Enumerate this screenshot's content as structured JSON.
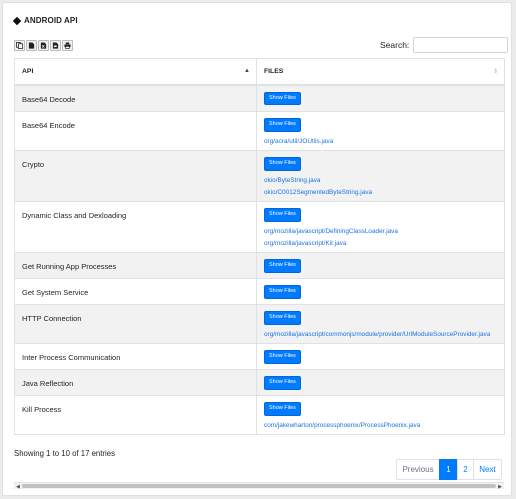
{
  "title": "ANDROID API",
  "toolbar": {
    "icons": [
      "copy-icon",
      "csv-icon",
      "excel-icon",
      "pdf-icon",
      "print-icon"
    ]
  },
  "search": {
    "label": "Search:",
    "value": "",
    "placeholder": ""
  },
  "table": {
    "headers": {
      "api": "API",
      "files": "FILES"
    },
    "button_label": "Show Files",
    "rows": [
      {
        "api": "Base64 Decode",
        "files": []
      },
      {
        "api": "Base64 Encode",
        "files": [
          "org/acra/util/JOUtils.java"
        ]
      },
      {
        "api": "Crypto",
        "files": [
          "okio/ByteString.java",
          "okio/C0012SegmentedByteString.java"
        ]
      },
      {
        "api": "Dynamic Class and Dexloading",
        "files": [
          "org/mozilla/javascript/DefiningClassLoader.java",
          "org/mozilla/javascript/Kit.java"
        ]
      },
      {
        "api": "Get Running App Processes",
        "files": []
      },
      {
        "api": "Get System Service",
        "files": []
      },
      {
        "api": "HTTP Connection",
        "files": [
          "org/mozilla/javascript/commonjs/module/provider/UrlModuleSourceProvider.java"
        ]
      },
      {
        "api": "Inter Process Communication",
        "files": []
      },
      {
        "api": "Java Reflection",
        "files": []
      },
      {
        "api": "Kill Process",
        "files": [
          "com/jakewharton/processphoenix/ProcessPhoenix.java"
        ]
      }
    ]
  },
  "info": "Showing 1 to 10 of 17 entries",
  "pagination": {
    "previous": "Previous",
    "pages": [
      "1",
      "2"
    ],
    "current": "1",
    "next": "Next"
  },
  "colors": {
    "accent": "#007bff",
    "link": "#1a73e8",
    "stripe": "#f2f2f2"
  }
}
